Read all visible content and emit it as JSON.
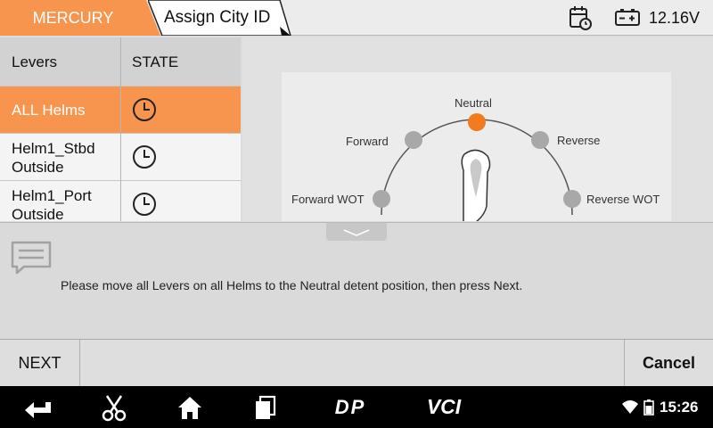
{
  "header": {
    "brand": "MERCURY",
    "page_title": "Assign City ID",
    "voltage": "12.16V",
    "accent": "#f7954f"
  },
  "table": {
    "columns": [
      "Levers",
      "STATE"
    ],
    "rows": [
      {
        "lever": "ALL Helms",
        "state": "clock-icon",
        "selected": true
      },
      {
        "lever": "Helm1_Stbd Outside",
        "state": "clock-icon",
        "selected": false
      },
      {
        "lever": "Helm1_Port Outside",
        "state": "clock-icon",
        "selected": false
      }
    ]
  },
  "diagram": {
    "positions": {
      "neutral": "Neutral",
      "forward": "Forward",
      "reverse": "Reverse",
      "forward_wot": "Forward WOT",
      "reverse_wot": "Reverse WOT"
    },
    "active_position": "Neutral",
    "active_color": "#f47a1f",
    "inactive_color": "#a8a8a8"
  },
  "message": {
    "text": "Please move all Levers on all Helms to the Neutral detent position, then press Next."
  },
  "actions": {
    "next_label": "NEXT",
    "cancel_label": "Cancel"
  },
  "system": {
    "time": "15:26",
    "nav_labels": [
      "DP",
      "VCI"
    ]
  }
}
